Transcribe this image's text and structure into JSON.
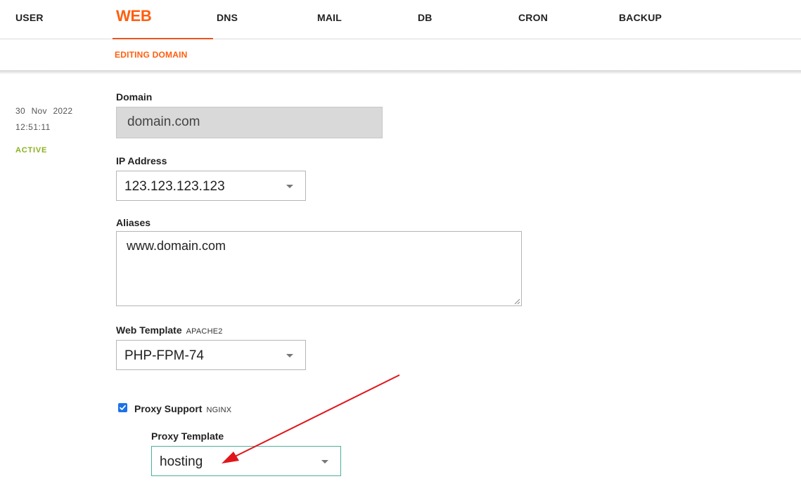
{
  "nav": {
    "items": [
      {
        "label": "USER"
      },
      {
        "label": "WEB"
      },
      {
        "label": "DNS"
      },
      {
        "label": "MAIL"
      },
      {
        "label": "DB"
      },
      {
        "label": "CRON"
      },
      {
        "label": "BACKUP"
      }
    ],
    "active": "WEB"
  },
  "subnav": {
    "title": "EDITING DOMAIN"
  },
  "meta": {
    "date": "30 Nov 2022",
    "time": "12:51:11",
    "status": "ACTIVE"
  },
  "form": {
    "domain": {
      "label": "Domain",
      "value": "domain.com"
    },
    "ip": {
      "label": "IP Address",
      "value": "123.123.123.123"
    },
    "aliases": {
      "label": "Aliases",
      "value": "www.domain.com"
    },
    "web_template": {
      "label": "Web Template",
      "hint": "APACHE2",
      "value": "PHP-FPM-74"
    },
    "proxy_support": {
      "label": "Proxy Support",
      "hint": "NGINX",
      "checked": true
    },
    "proxy_template": {
      "label": "Proxy Template",
      "value": "hosting"
    }
  },
  "colors": {
    "accent": "#ff5e0e",
    "active_status": "#8bb11e",
    "annotation_arrow": "#e0161b",
    "focus_border": "#4cb09a",
    "checkbox": "#1a73e8"
  },
  "icons": {
    "caret": "caret-down-icon",
    "check": "checkmark-icon",
    "annotation": "red-arrow-annotation"
  }
}
